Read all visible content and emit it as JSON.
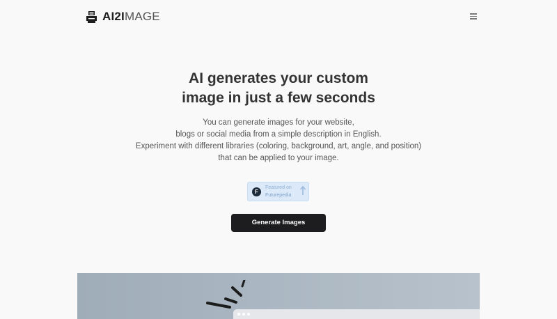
{
  "header": {
    "logo_bold": "AI2I",
    "logo_light": "MAGE",
    "logo_icon": "printer-icon",
    "menu_icon": "hamburger-menu-icon"
  },
  "hero": {
    "title_lines": [
      "AI generates your custom",
      "image in just a few seconds"
    ],
    "description_lines": [
      "You can generate images for your website,",
      "blogs or social media from a simple description in English.",
      "Experiment with different libraries (coloring, background, art, angle, and position)",
      "that can be applied to your image."
    ]
  },
  "badge": {
    "letter": "F",
    "label": "Featured on",
    "sub": "Futurepedia",
    "icon": "arrow-up-icon"
  },
  "cta": {
    "generate_label": "Generate Images"
  },
  "colors": {
    "background": "#f9f9f9",
    "button": "#1d1d1f",
    "badge": "#dbe9f8",
    "preview": "#aab6c1"
  }
}
